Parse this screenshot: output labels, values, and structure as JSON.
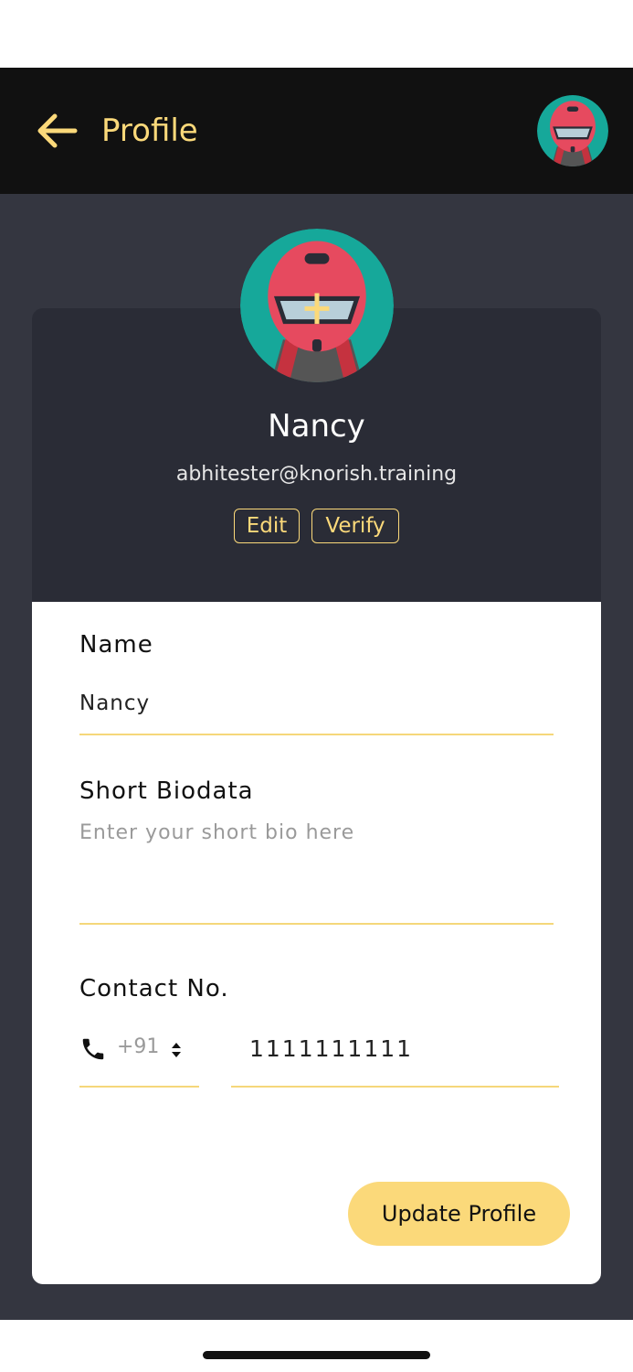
{
  "header": {
    "title": "Profile",
    "back_icon": "arrow-left-icon",
    "avatar_icon": "helmet-rider-avatar"
  },
  "profile": {
    "name": "Nancy",
    "email": "abhitester@knorish.training",
    "edit_label": "Edit",
    "verify_label": "Verify"
  },
  "form": {
    "name_label": "Name",
    "name_value": "Nancy",
    "bio_label": "Short Biodata",
    "bio_placeholder": "Enter your short bio here",
    "contact_label": "Contact No.",
    "country_code": "+91",
    "phone_value": "1111111111",
    "phone_icon": "phone-icon",
    "update_label": "Update Profile"
  },
  "colors": {
    "accent": "#fbd97a",
    "header_bg": "#111111",
    "page_bg": "#343640",
    "card_top_bg": "#2a2c36",
    "avatar_bg": "#16a89a",
    "helmet": "#e64a5f"
  }
}
